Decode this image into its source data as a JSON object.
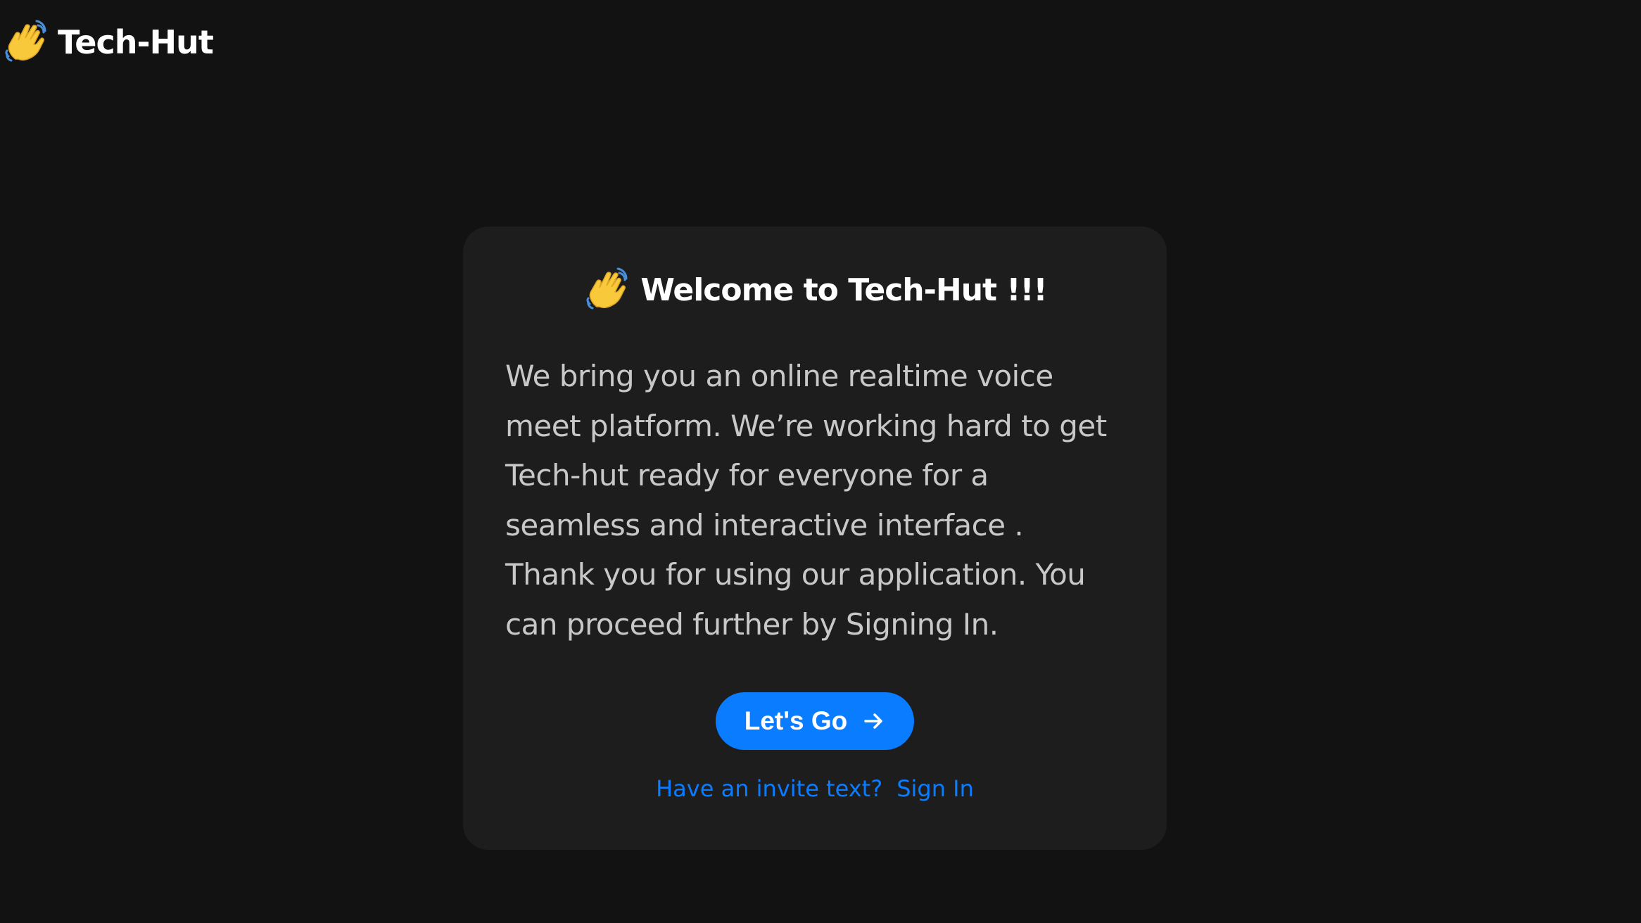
{
  "header": {
    "logo_icon": "waving-hand-icon",
    "title": "Tech-Hut"
  },
  "card": {
    "heading_icon": "waving-hand-icon",
    "heading": "Welcome to Tech-Hut !!!",
    "body": "We bring you an online realtime voice meet platform. We’re working hard to get Tech-hut ready for everyone for a seamless and interactive interface . Thank you for using our application. You can proceed further by Signing In.",
    "cta_label": "Let's Go",
    "cta_icon": "arrow-right-icon",
    "invite_prompt": "Have an invite text?",
    "signin_label": "Sign In"
  },
  "colors": {
    "background": "#121212",
    "card": "#1d1d1d",
    "accent": "#0a7cff",
    "body_text": "#c8c8c8",
    "emoji_yellow": "#f7c93b",
    "emoji_blue": "#4a8fd6"
  }
}
